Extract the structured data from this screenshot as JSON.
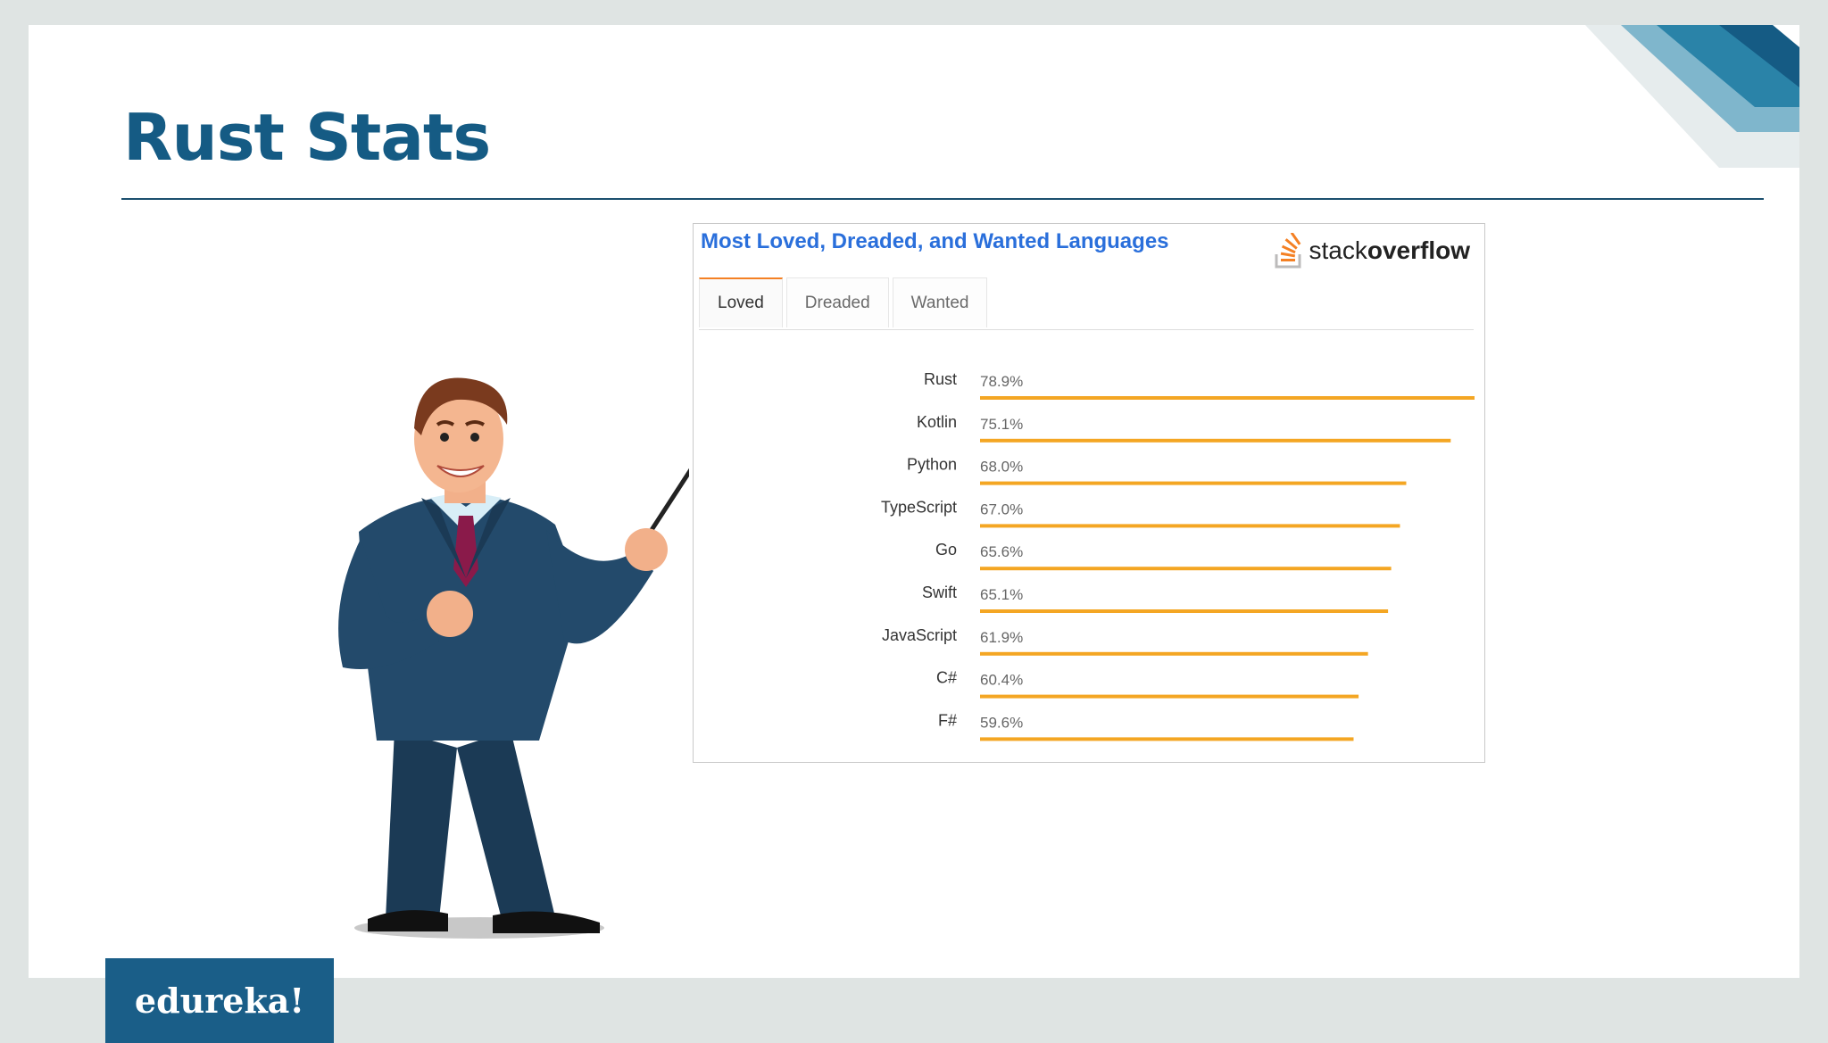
{
  "slide": {
    "title": "Rust Stats"
  },
  "panel": {
    "title": "Most Loved, Dreaded, and Wanted Languages",
    "logo": {
      "light": "stack",
      "bold": "overflow"
    },
    "tabs": [
      {
        "label": "Loved",
        "active": true
      },
      {
        "label": "Dreaded",
        "active": false
      },
      {
        "label": "Wanted",
        "active": false
      }
    ]
  },
  "chart_data": {
    "type": "bar",
    "orientation": "horizontal",
    "categories": [
      "Rust",
      "Kotlin",
      "Python",
      "TypeScript",
      "Go",
      "Swift",
      "JavaScript",
      "C#",
      "F#"
    ],
    "values": [
      78.9,
      75.1,
      68.0,
      67.0,
      65.6,
      65.1,
      61.9,
      60.4,
      59.6
    ],
    "value_labels": [
      "78.9%",
      "75.1%",
      "68.0%",
      "67.0%",
      "65.6%",
      "65.1%",
      "61.9%",
      "60.4%",
      "59.6%"
    ],
    "xlim": [
      0,
      78.9
    ],
    "bar_color": "#f4a623",
    "grid": false
  },
  "brand": {
    "name": "edureka!"
  },
  "colors": {
    "title": "#155b84",
    "accent": "#f48024",
    "brand_bg": "#1a5e88"
  }
}
